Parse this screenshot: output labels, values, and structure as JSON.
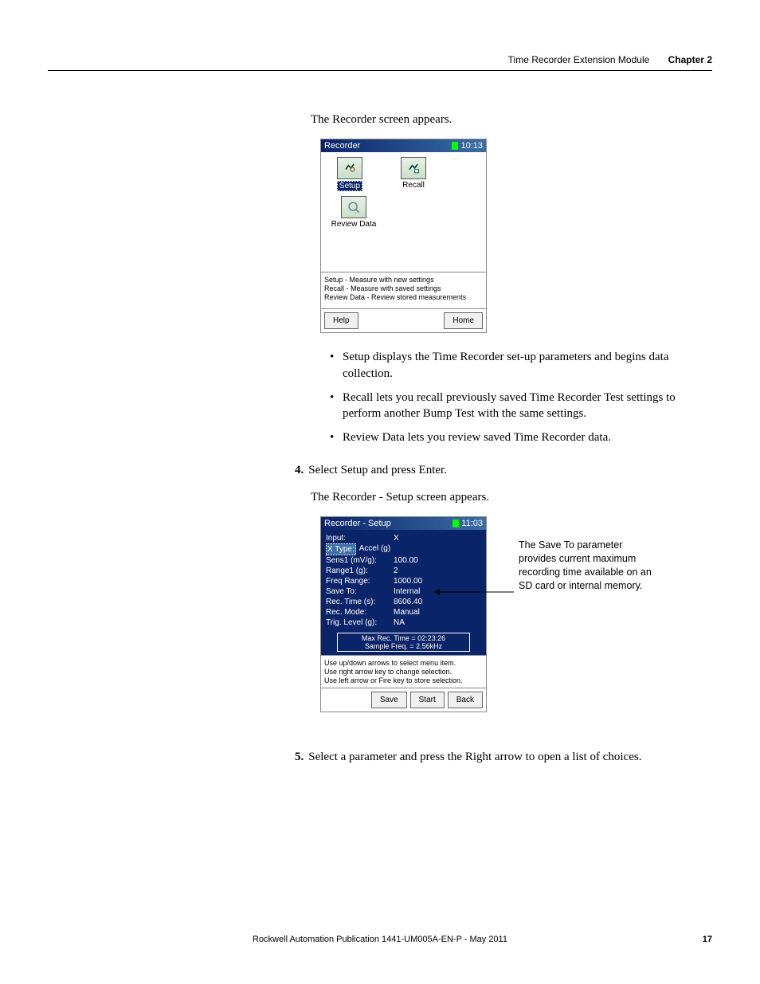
{
  "header": {
    "title": "Time Recorder Extension Module",
    "chapter": "Chapter 2"
  },
  "intro": "The Recorder screen appears.",
  "screen1": {
    "title": "Recorder",
    "time": "10:13",
    "icons": {
      "setup": "Setup",
      "recall": "Recall",
      "review": "Review Data"
    },
    "desc1": "Setup - Measure with new settings",
    "desc2": "Recall - Measure with saved settings",
    "desc3": "Review Data - Review stored measurements",
    "btn_help": "Help",
    "btn_home": "Home"
  },
  "bullets": [
    "Setup displays the Time Recorder set-up parameters and begins data collection.",
    "Recall lets you recall previously saved Time Recorder Test settings to perform another Bump Test with the same settings.",
    "Review Data lets you review saved Time Recorder data."
  ],
  "step4": {
    "num": "4.",
    "text": "Select Setup and press Enter."
  },
  "step4_after": "The Recorder - Setup screen appears.",
  "screen2": {
    "title": "Recorder - Setup",
    "time": "11:03",
    "rows": [
      {
        "k": "Input:",
        "v": "X"
      },
      {
        "k": "X Type:",
        "v": "Accel (g)",
        "selected": true
      },
      {
        "k": "Sens1 (mV/g):",
        "v": "100.00"
      },
      {
        "k": "Range1 (g):",
        "v": "2"
      },
      {
        "k": "Freq Range:",
        "v": "1000.00"
      },
      {
        "k": "Save To:",
        "v": "Internal"
      },
      {
        "k": "Rec. Time (s):",
        "v": "8606.40"
      },
      {
        "k": "Rec. Mode:",
        "v": "Manual"
      },
      {
        "k": "Trig. Level (g):",
        "v": "NA"
      }
    ],
    "center1": "Max Rec. Time = 02:23:26",
    "center2": "Sample Freq. = 2.56kHz",
    "help1": "Use up/down arrows to select menu item.",
    "help2": "Use right arrow key to change selection.",
    "help3": "Use left arrow or Fire key to store selection.",
    "btn_save": "Save",
    "btn_start": "Start",
    "btn_back": "Back"
  },
  "callout": "The Save To parameter provides current maximum recording time available on an SD card or internal memory.",
  "step5": {
    "num": "5.",
    "text": "Select a parameter and press the Right arrow to open a list of choices."
  },
  "footer": {
    "pub": "Rockwell Automation Publication 1441-UM005A-EN-P - May 2011",
    "page": "17"
  }
}
